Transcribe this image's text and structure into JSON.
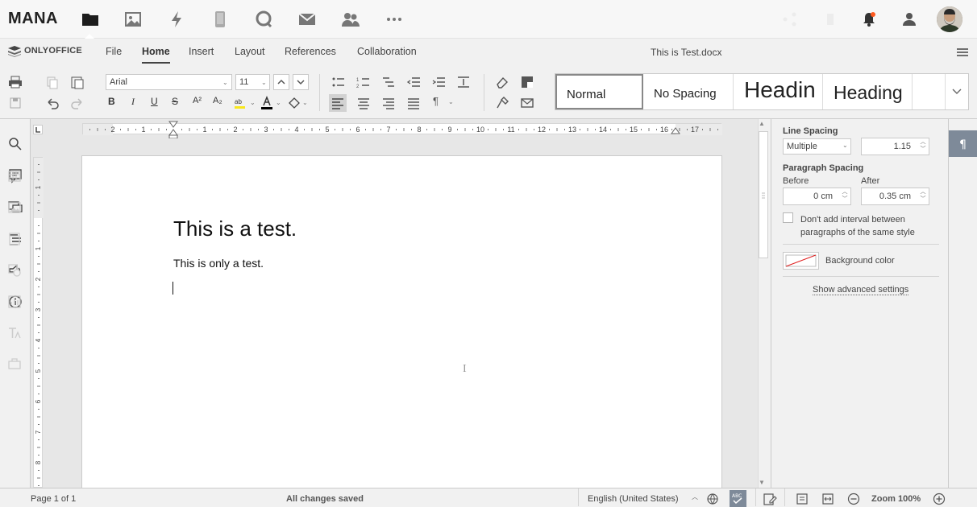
{
  "app": {
    "brand": "MANA",
    "nav_icons": [
      "files-icon",
      "image-icon",
      "bolt-icon",
      "phone-icon",
      "chat-icon",
      "mail-icon",
      "contacts-icon",
      "more-icon"
    ],
    "notification_color": "#ff5a1f"
  },
  "editor": {
    "logo_text": "ONLYOFFICE",
    "tabs": [
      {
        "label": "File"
      },
      {
        "label": "Home",
        "active": true
      },
      {
        "label": "Insert"
      },
      {
        "label": "Layout"
      },
      {
        "label": "References"
      },
      {
        "label": "Collaboration"
      }
    ],
    "document_title": "This is Test.docx"
  },
  "toolbar": {
    "font_name": "Arial",
    "font_size": "11",
    "styles": [
      "Normal",
      "No Spacing",
      "Headin",
      "Heading"
    ],
    "font_color": "#000000",
    "highlight_color": "#f8e71c"
  },
  "document": {
    "heading": "This is a test.",
    "body": "This is only a test.",
    "ruler_h": [
      "2",
      "1",
      "1",
      "2",
      "3",
      "4",
      "5",
      "6",
      "7",
      "8",
      "9",
      "10",
      "11",
      "12",
      "13",
      "14",
      "15",
      "16",
      "17"
    ],
    "ruler_v": [
      "1",
      "1",
      "2",
      "3",
      "4",
      "5",
      "6",
      "7",
      "8"
    ]
  },
  "panel": {
    "line_spacing_label": "Line Spacing",
    "line_spacing_type": "Multiple",
    "line_spacing_value": "1.15",
    "paragraph_spacing_label": "Paragraph Spacing",
    "before_label": "Before",
    "before_value": "0 cm",
    "after_label": "After",
    "after_value": "0.35 cm",
    "no_interval_label": "Don't add interval between paragraphs of the same style",
    "no_interval_checked": false,
    "background_color_label": "Background color",
    "advanced_link": "Show advanced settings"
  },
  "status": {
    "page_info": "Page 1 of 1",
    "save_state": "All changes saved",
    "language": "English (United States)",
    "zoom": "Zoom 100%"
  }
}
